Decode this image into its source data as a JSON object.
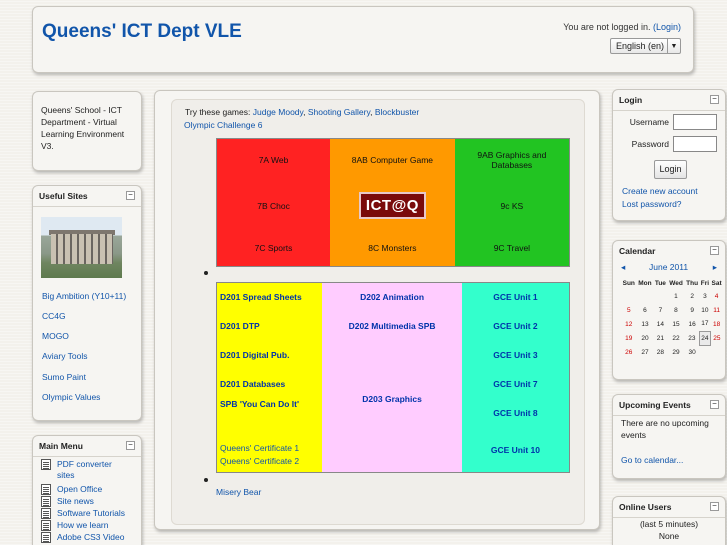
{
  "header": {
    "title": "Queens' ICT Dept VLE",
    "login_status_prefix": "You are not logged in.",
    "login_link": "(Login)",
    "language": "English (en)"
  },
  "about": {
    "text": "Queens' School - ICT Department - Virtual Learning Environment V3."
  },
  "useful_sites": {
    "title": "Useful Sites",
    "links": [
      "Big Ambition (Y10+11)",
      "CC4G",
      "MOGO",
      "Aviary Tools",
      "Sumo Paint",
      "Olympic Values"
    ]
  },
  "main_menu": {
    "title": "Main Menu",
    "items": [
      "PDF converter sites",
      "Open Office",
      "Site news",
      "Software Tutorials",
      "How we learn",
      "Adobe CS3 Video"
    ]
  },
  "center": {
    "games_intro": "Try these games:",
    "games": [
      "Judge Moody",
      "Shooting Gallery",
      "Blockbuster",
      "Olympic Challenge 6"
    ],
    "year_grid": {
      "r1": [
        "7A Web",
        "8AB Computer Game",
        "9AB Graphics and Databases"
      ],
      "r2": [
        "7B Choc",
        "ICT@Q",
        "9c KS"
      ],
      "r3": [
        "7C Sports",
        "8C Monsters",
        "9C Travel"
      ]
    },
    "unit_grid": {
      "col1": [
        "D201 Spread Sheets",
        "D201 DTP",
        "D201 Digital Pub.",
        "D201 Databases",
        "SPB 'You Can Do It'",
        "Queens' Certificate 1",
        "Queens' Certificate 2"
      ],
      "col2": [
        "D202 Animation",
        "D202 Multimedia SPB",
        "D203 Graphics"
      ],
      "col3": [
        "GCE Unit 1",
        "GCE Unit 2",
        "GCE Unit 3",
        "GCE Unit 7",
        "GCE Unit 8",
        "GCE Unit 10"
      ]
    },
    "misery_bear": "Misery Bear"
  },
  "login": {
    "title": "Login",
    "username_label": "Username",
    "password_label": "Password",
    "button": "Login",
    "create_account": "Create new account",
    "lost_password": "Lost password?"
  },
  "calendar": {
    "title": "Calendar",
    "month": "June 2011",
    "days": [
      "Sun",
      "Mon",
      "Tue",
      "Wed",
      "Thu",
      "Fri",
      "Sat"
    ],
    "weeks": [
      [
        "",
        "",
        "",
        "1",
        "2",
        "3",
        "4"
      ],
      [
        "5",
        "6",
        "7",
        "8",
        "9",
        "10",
        "11"
      ],
      [
        "12",
        "13",
        "14",
        "15",
        "16",
        "17",
        "18"
      ],
      [
        "19",
        "20",
        "21",
        "22",
        "23",
        "24",
        "25"
      ],
      [
        "26",
        "27",
        "28",
        "29",
        "30",
        "",
        ""
      ]
    ]
  },
  "upcoming_events": {
    "title": "Upcoming Events",
    "text": "There are no upcoming events",
    "link": "Go to calendar..."
  },
  "online_users": {
    "title": "Online Users",
    "period": "(last 5 minutes)",
    "none": "None"
  },
  "colors": {
    "link": "#1155aa",
    "red": "#ff2222",
    "orange": "#ff9900",
    "green": "#22c422",
    "yellow": "#ffff00",
    "pink": "#ffccff",
    "aqua": "#33ffcc"
  }
}
